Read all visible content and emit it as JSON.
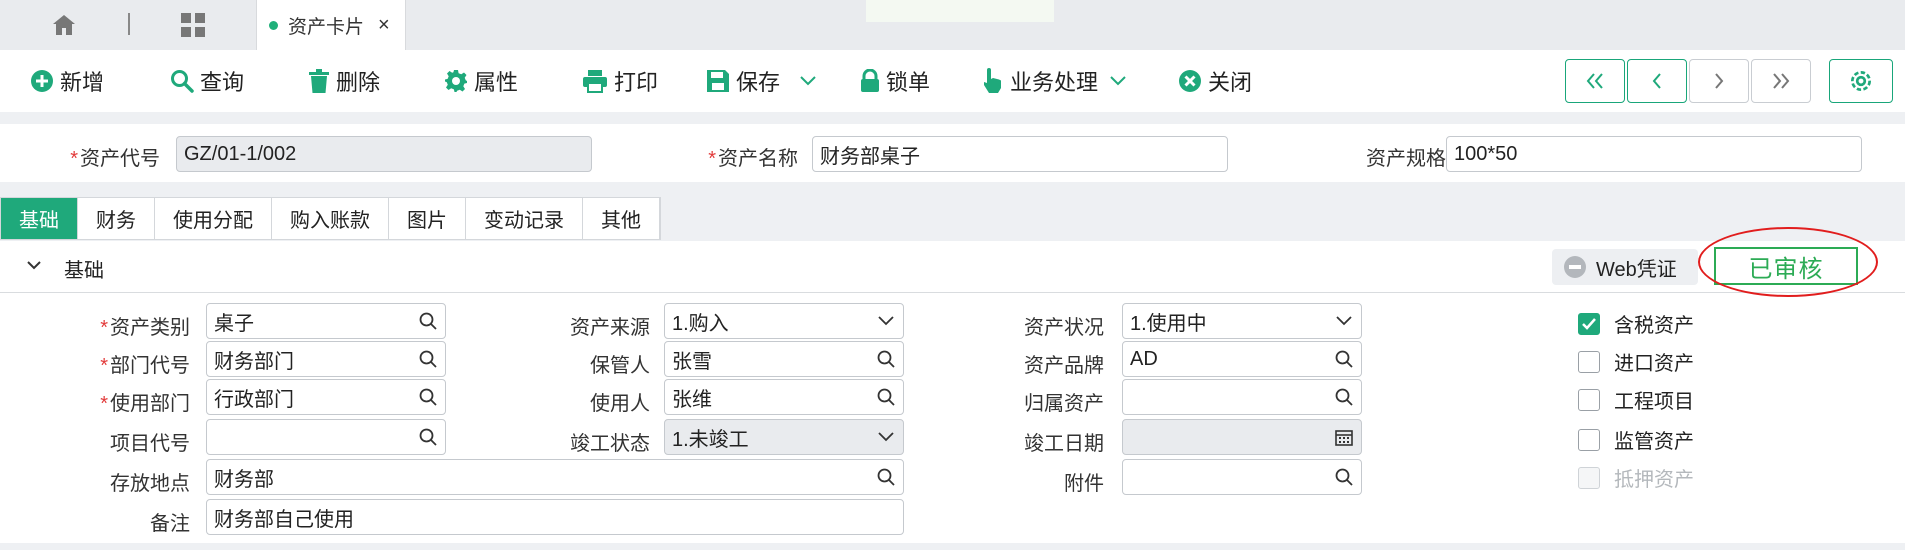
{
  "tabbar": {
    "icons": [
      "home-icon",
      "grid-icon"
    ],
    "active_tab": "资产卡片",
    "close": "×"
  },
  "toolbar": {
    "add": "新增",
    "query": "查询",
    "delete": "删除",
    "props": "属性",
    "print": "打印",
    "save": "保存",
    "lock": "锁单",
    "business": "业务处理",
    "close": "关闭"
  },
  "header": {
    "code_label": "资产代号",
    "code_value": "GZ/01-1/002",
    "name_label": "资产名称",
    "name_value": "财务部桌子",
    "spec_label": "资产规格",
    "spec_value": "100*50"
  },
  "subtabs": [
    "基础",
    "财务",
    "使用分配",
    "购入账款",
    "图片",
    "变动记录",
    "其他"
  ],
  "section": {
    "title": "基础",
    "web_btn": "Web凭证",
    "stamp": "已审核"
  },
  "form": {
    "category_label": "资产类别",
    "category_value": "桌子",
    "dept_label": "部门代号",
    "dept_value": "财务部门",
    "usedept_label": "使用部门",
    "usedept_value": "行政部门",
    "project_label": "项目代号",
    "project_value": "",
    "location_label": "存放地点",
    "location_value": "财务部",
    "remark_label": "备注",
    "remark_value": "财务部自己使用",
    "source_label": "资产来源",
    "source_value": "1.购入",
    "keeper_label": "保管人",
    "keeper_value": "张雪",
    "user_label": "使用人",
    "user_value": "张维",
    "complete_label": "竣工状态",
    "complete_value": "1.未竣工",
    "status_label": "资产状况",
    "status_value": "1.使用中",
    "brand_label": "资产品牌",
    "brand_value": "AD",
    "belong_label": "归属资产",
    "belong_value": "",
    "complete_date_label": "竣工日期",
    "complete_date_value": "",
    "attach_label": "附件",
    "attach_value": ""
  },
  "checks": [
    {
      "label": "含税资产",
      "checked": true
    },
    {
      "label": "进口资产",
      "checked": false
    },
    {
      "label": "工程项目",
      "checked": false
    },
    {
      "label": "监管资产",
      "checked": false
    },
    {
      "label": "抵押资产",
      "checked": false,
      "disabled": true
    }
  ],
  "colors": {
    "accent": "#1fa97b",
    "required": "#e23b3b",
    "stamp": "#2cab55",
    "highlight": "#e11d1d"
  }
}
